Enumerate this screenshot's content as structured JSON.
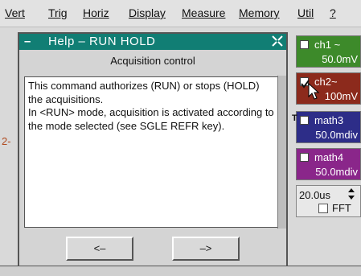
{
  "menu": {
    "items": [
      {
        "label": "Vert"
      },
      {
        "label": "Trig"
      },
      {
        "label": "Horiz"
      },
      {
        "label": "Display"
      },
      {
        "label": "Measure"
      },
      {
        "label": "Memory"
      },
      {
        "label": "Util"
      },
      {
        "label": "?"
      }
    ]
  },
  "help": {
    "title": "Help – RUN HOLD",
    "minimize_glyph": "–",
    "subtitle": "Acquisition control",
    "paragraphs": [
      "This command authorizes (RUN) or stops (HOLD) the acquisitions.",
      "In <RUN> mode, acquisition is activated according to the mode selected (see SGLE REFR key)."
    ],
    "prev_label": "<–",
    "next_label": "–>"
  },
  "channels": [
    {
      "name": "ch1 ~",
      "value": "50.0mV",
      "color": "#3d8a2a",
      "checked": false
    },
    {
      "name": "ch2~",
      "value": "100mV",
      "color": "#8c2a1c",
      "checked": true
    },
    {
      "name": "math3",
      "value": "50.0mdiv",
      "color": "#2d2d88",
      "checked": false
    },
    {
      "name": "math4",
      "value": "50.0mdiv",
      "color": "#8a268a",
      "checked": false
    }
  ],
  "timebase": {
    "value": "20.0us",
    "fft_label": "FFT"
  },
  "markers": {
    "ch2": "2-",
    "trigger": "T"
  }
}
